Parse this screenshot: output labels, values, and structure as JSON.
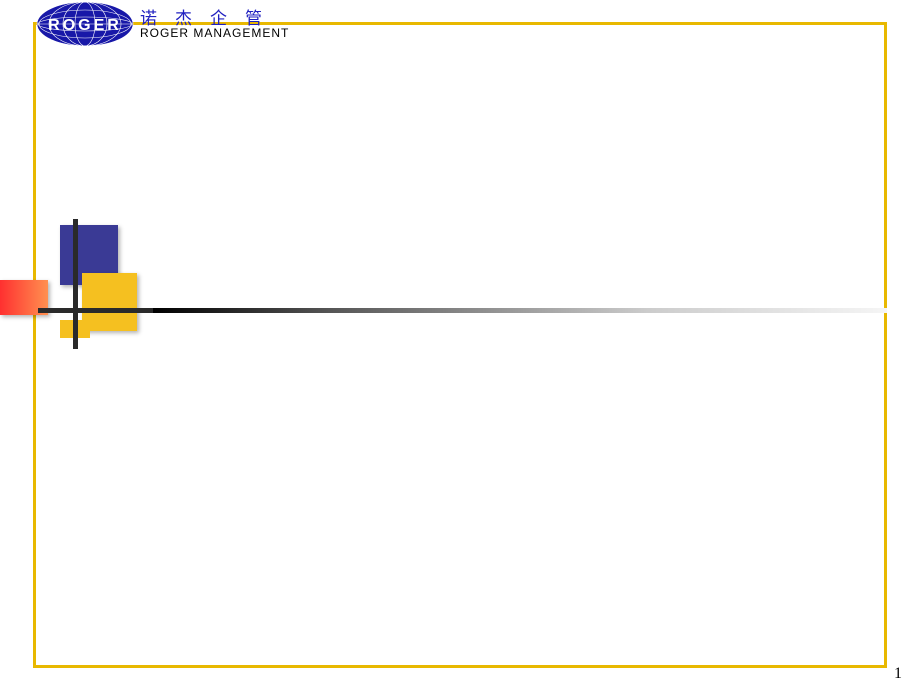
{
  "header": {
    "title_cn": "诺杰企管",
    "title_en": "ROGER  MANAGEMENT",
    "logo_text": "ROGER"
  },
  "page_number": "1"
}
